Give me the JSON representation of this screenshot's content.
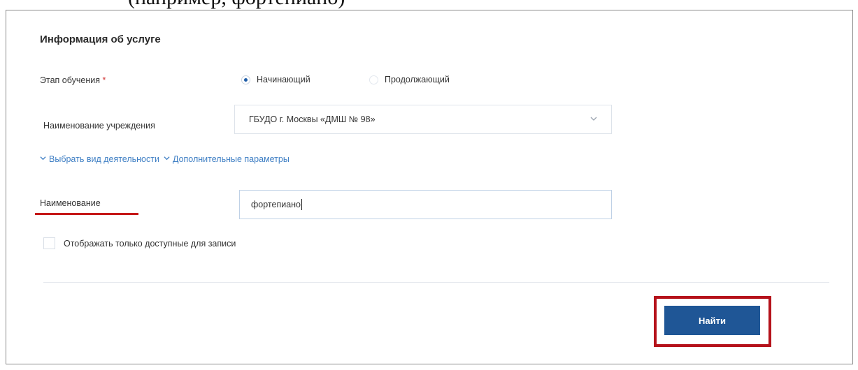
{
  "fragment": {
    "top_text": "(например, фортепиано)"
  },
  "form": {
    "section_title": "Информация об услуге",
    "stage": {
      "label": "Этап обучения",
      "required_mark": "*",
      "options": [
        {
          "label": "Начинающий",
          "selected": true
        },
        {
          "label": "Продолжающий",
          "selected": false
        }
      ]
    },
    "institution": {
      "label": "Наименование учреждения",
      "selected_value": "ГБУДО г. Москвы «ДМШ № 98»",
      "chevron_icon": "chevron-down-icon"
    },
    "links": {
      "activity_type": "Выбрать вид деятельности",
      "extra_params": "Дополнительные параметры"
    },
    "name": {
      "label": "Наименование",
      "value": "фортепиано"
    },
    "only_available": {
      "label": "Отображать только доступные для записи",
      "checked": false
    },
    "search_button": "Найти"
  },
  "colors": {
    "accent": "#1f5696",
    "link": "#3f7fc4",
    "highlight": "#b5121b"
  }
}
